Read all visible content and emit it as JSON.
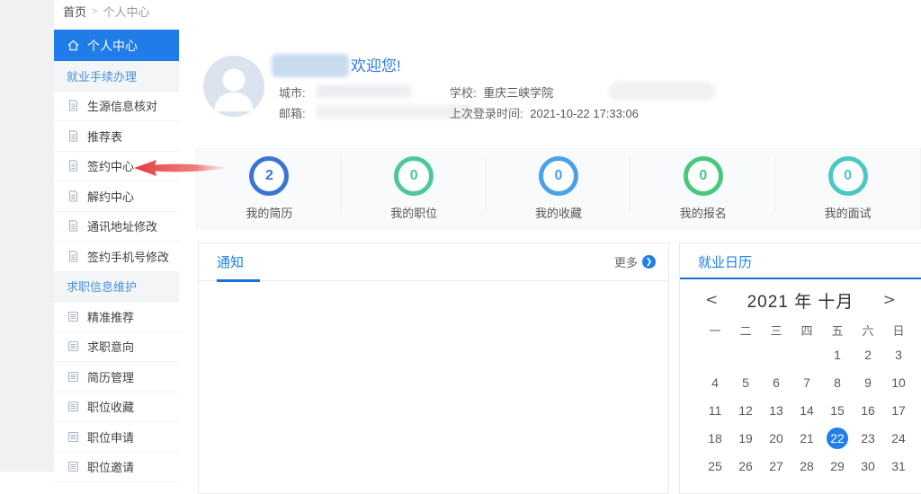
{
  "colors": {
    "accent": "#2080e8",
    "sidebar_active_bg": "#1f7ce8",
    "underline_blue": "#1a6fd8",
    "section_link_blue": "#4a90e2",
    "arrow_red": "#e23c3c"
  },
  "breadcrumb": {
    "home": "首页",
    "sep": ">",
    "current": "个人中心"
  },
  "sidebar": {
    "items": [
      {
        "label": "个人中心",
        "type": "active",
        "icon": "home-icon"
      },
      {
        "label": "就业手续办理",
        "type": "section"
      },
      {
        "label": "生源信息核对",
        "type": "item",
        "icon": "document-icon"
      },
      {
        "label": "推荐表",
        "type": "item",
        "icon": "document-icon"
      },
      {
        "label": "签约中心",
        "type": "item",
        "icon": "document-icon"
      },
      {
        "label": "解约中心",
        "type": "item",
        "icon": "document-icon"
      },
      {
        "label": "通讯地址修改",
        "type": "item",
        "icon": "document-icon"
      },
      {
        "label": "签约手机号修改",
        "type": "item",
        "icon": "document-icon"
      },
      {
        "label": "求职信息维护",
        "type": "section"
      },
      {
        "label": "精准推荐",
        "type": "item",
        "icon": "list-icon"
      },
      {
        "label": "求职意向",
        "type": "item",
        "icon": "list-icon"
      },
      {
        "label": "简历管理",
        "type": "item",
        "icon": "list-icon"
      },
      {
        "label": "职位收藏",
        "type": "item",
        "icon": "list-icon"
      },
      {
        "label": "职位申请",
        "type": "item",
        "icon": "list-icon"
      },
      {
        "label": "职位邀请",
        "type": "item",
        "icon": "list-icon"
      }
    ]
  },
  "profile": {
    "welcome": "欢迎您!",
    "city_label": "城市:",
    "email_label": "邮箱:",
    "school_label": "学校:",
    "school_value": "重庆三峡学院",
    "last_login_label": "上次登录时间:",
    "last_login_value": "2021-10-22 17:33:06"
  },
  "stats": [
    {
      "value": "2",
      "label": "我的简历",
      "color": "#3b74d6"
    },
    {
      "value": "0",
      "label": "我的职位",
      "color": "#4ec79a"
    },
    {
      "value": "0",
      "label": "我的收藏",
      "color": "#49a2e8"
    },
    {
      "value": "0",
      "label": "我的报名",
      "color": "#46c87d"
    },
    {
      "value": "0",
      "label": "我的面试",
      "color": "#4bc8c2"
    }
  ],
  "notice": {
    "title": "通知",
    "more": "更多",
    "more_icon_glyph": "❯"
  },
  "calendar": {
    "title": "就业日历",
    "prev": "<",
    "next": ">",
    "year_month": "2021 年  十月",
    "weekdays": [
      "一",
      "二",
      "三",
      "四",
      "五",
      "六",
      "日"
    ],
    "weeks": [
      [
        "",
        "",
        "",
        "",
        "1",
        "2",
        "3"
      ],
      [
        "4",
        "5",
        "6",
        "7",
        "8",
        "9",
        "10"
      ],
      [
        "11",
        "12",
        "13",
        "14",
        "15",
        "16",
        "17"
      ],
      [
        "18",
        "19",
        "20",
        "21",
        "22",
        "23",
        "24"
      ],
      [
        "25",
        "26",
        "27",
        "28",
        "29",
        "30",
        "31"
      ]
    ],
    "selected_day": "22"
  }
}
